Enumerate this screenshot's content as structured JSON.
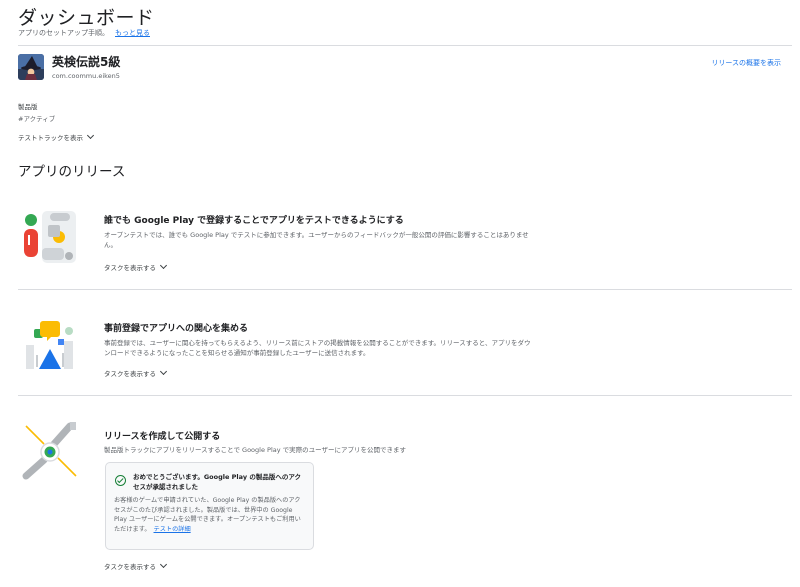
{
  "header": {
    "title": "ダッシュボード",
    "subtitle": "アプリのセットアップ手順。",
    "more_link": "もっと見る"
  },
  "app": {
    "name": "英検伝説5級",
    "package": "com.coommu.eiken5",
    "overview_link": "リリースの概要を表示",
    "track_label": "製品版",
    "track_status": "#アクティブ",
    "test_tracks_toggle": "テストトラックを表示",
    "icon": "wizard-app-icon"
  },
  "releases": {
    "heading": "アプリのリリース",
    "cards": [
      {
        "title": "誰でも Google Play で登録することでアプリをテストできるようにする",
        "body": "オープンテストでは、誰でも Google Play でテストに参加できます。ユーザーからのフィードバックが一般公開の評価に影響することはありません。",
        "toggle": "タスクを表示する"
      },
      {
        "title": "事前登録でアプリへの関心を集める",
        "body": "事前登録では、ユーザーに関心を持ってもらえるよう、リリース前にストアの掲載情報を公開することができます。リリースすると、アプリをダウンロードできるようになったことを知らせる通知が事前登録したユーザーに送信されます。",
        "toggle": "タスクを表示する"
      },
      {
        "title": "リリースを作成して公開する",
        "body": "製品版トラックにアプリをリリースすることで Google Play で実際のユーザーにアプリを公開できます",
        "toggle": "タスクを表示する"
      }
    ],
    "success": {
      "title": "おめでとうございます。Google Play の製品版へのアクセスが承認されました",
      "body": "お客様のゲームで申請されていた、Google Play の製品版へのアクセスがこのたび承認されました。製品版では、世界中の Google Play ユーザーにゲームを公開できます。オープンテストもご利用いただけます。",
      "link": "テストの詳細"
    }
  },
  "colors": {
    "accent": "#1a73e8",
    "success": "#188038",
    "divider": "#dadce0"
  }
}
